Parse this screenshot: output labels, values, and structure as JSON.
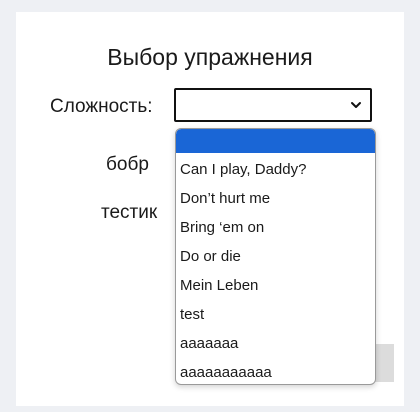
{
  "page": {
    "title": "Выбор упражнения"
  },
  "form": {
    "difficulty_label": "Сложность:",
    "row1_label": "бобр",
    "row2_label": "тестик"
  },
  "select": {
    "current_value": "",
    "options": [
      "",
      "Can I play, Daddy?",
      "Don’t hurt me",
      "Bring ‘em on",
      "Do or die",
      "Mein Leben",
      "test",
      "aaaaaaa",
      "aaaaaaaaaaa"
    ]
  },
  "colors": {
    "highlight": "#1a66d6",
    "card_background": "#ffffff",
    "page_background": "#eef0f4"
  }
}
